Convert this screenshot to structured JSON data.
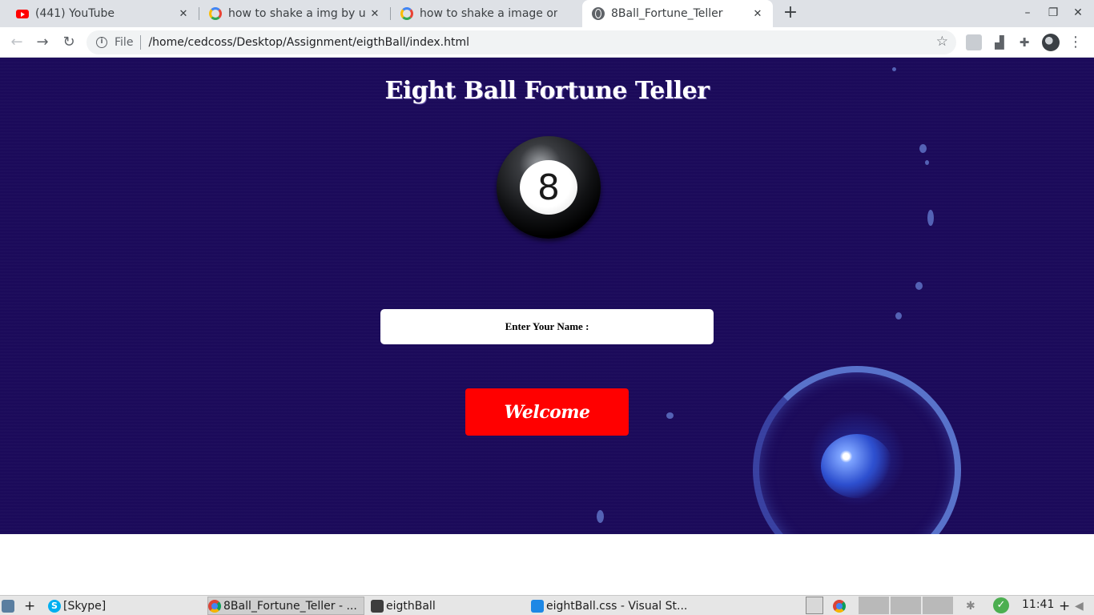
{
  "browser": {
    "tabs": [
      {
        "title": "(441) YouTube",
        "favicon": "youtube-icon"
      },
      {
        "title": "how to shake a img by usi",
        "favicon": "google-icon"
      },
      {
        "title": "how to shake a image on a",
        "favicon": "google-icon"
      },
      {
        "title": "8Ball_Fortune_Teller",
        "favicon": "globe-icon",
        "active": true
      }
    ],
    "new_tab": "+",
    "address": {
      "scheme_label": "File",
      "url": "/home/cedcoss/Desktop/Assignment/eigthBall/index.html"
    }
  },
  "page": {
    "title": "Eight Ball Fortune Teller",
    "ball_number": "8",
    "name_placeholder": "Enter Your Name :",
    "welcome_button": "Welcome",
    "colors": {
      "background": "#1b0a5a",
      "button": "#ff0000"
    }
  },
  "taskbar": {
    "items": [
      {
        "label": "[Skype]",
        "icon": "skype-icon"
      },
      {
        "label": "8Ball_Fortune_Teller - ...",
        "icon": "chrome-icon",
        "active": true
      },
      {
        "label": "eigthBall",
        "icon": "folder-icon"
      },
      {
        "label": "eightBall.css - Visual St...",
        "icon": "vscode-icon"
      }
    ],
    "add": "+",
    "clock": "11:41"
  }
}
